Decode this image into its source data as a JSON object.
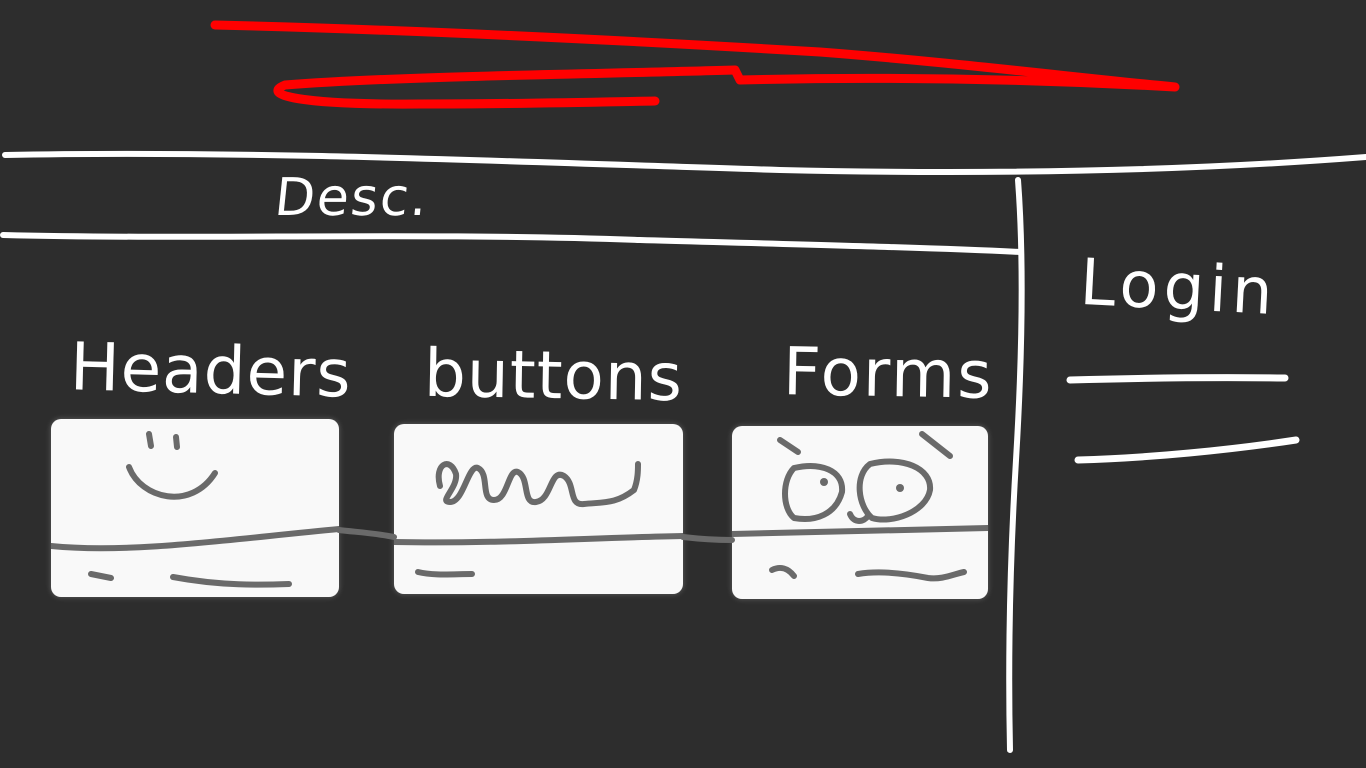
{
  "desc_area": {
    "label": "Desc."
  },
  "sections": [
    {
      "label": "Headers"
    },
    {
      "label": "buttons"
    },
    {
      "label": "Forms"
    }
  ],
  "login_panel": {
    "label": "Login"
  },
  "colors": {
    "background": "#2d2d2d",
    "chalk": "#ffffff",
    "scribble": "#ff0000",
    "card": "#f9f9f9",
    "card_ink": "#6a6a6a"
  }
}
